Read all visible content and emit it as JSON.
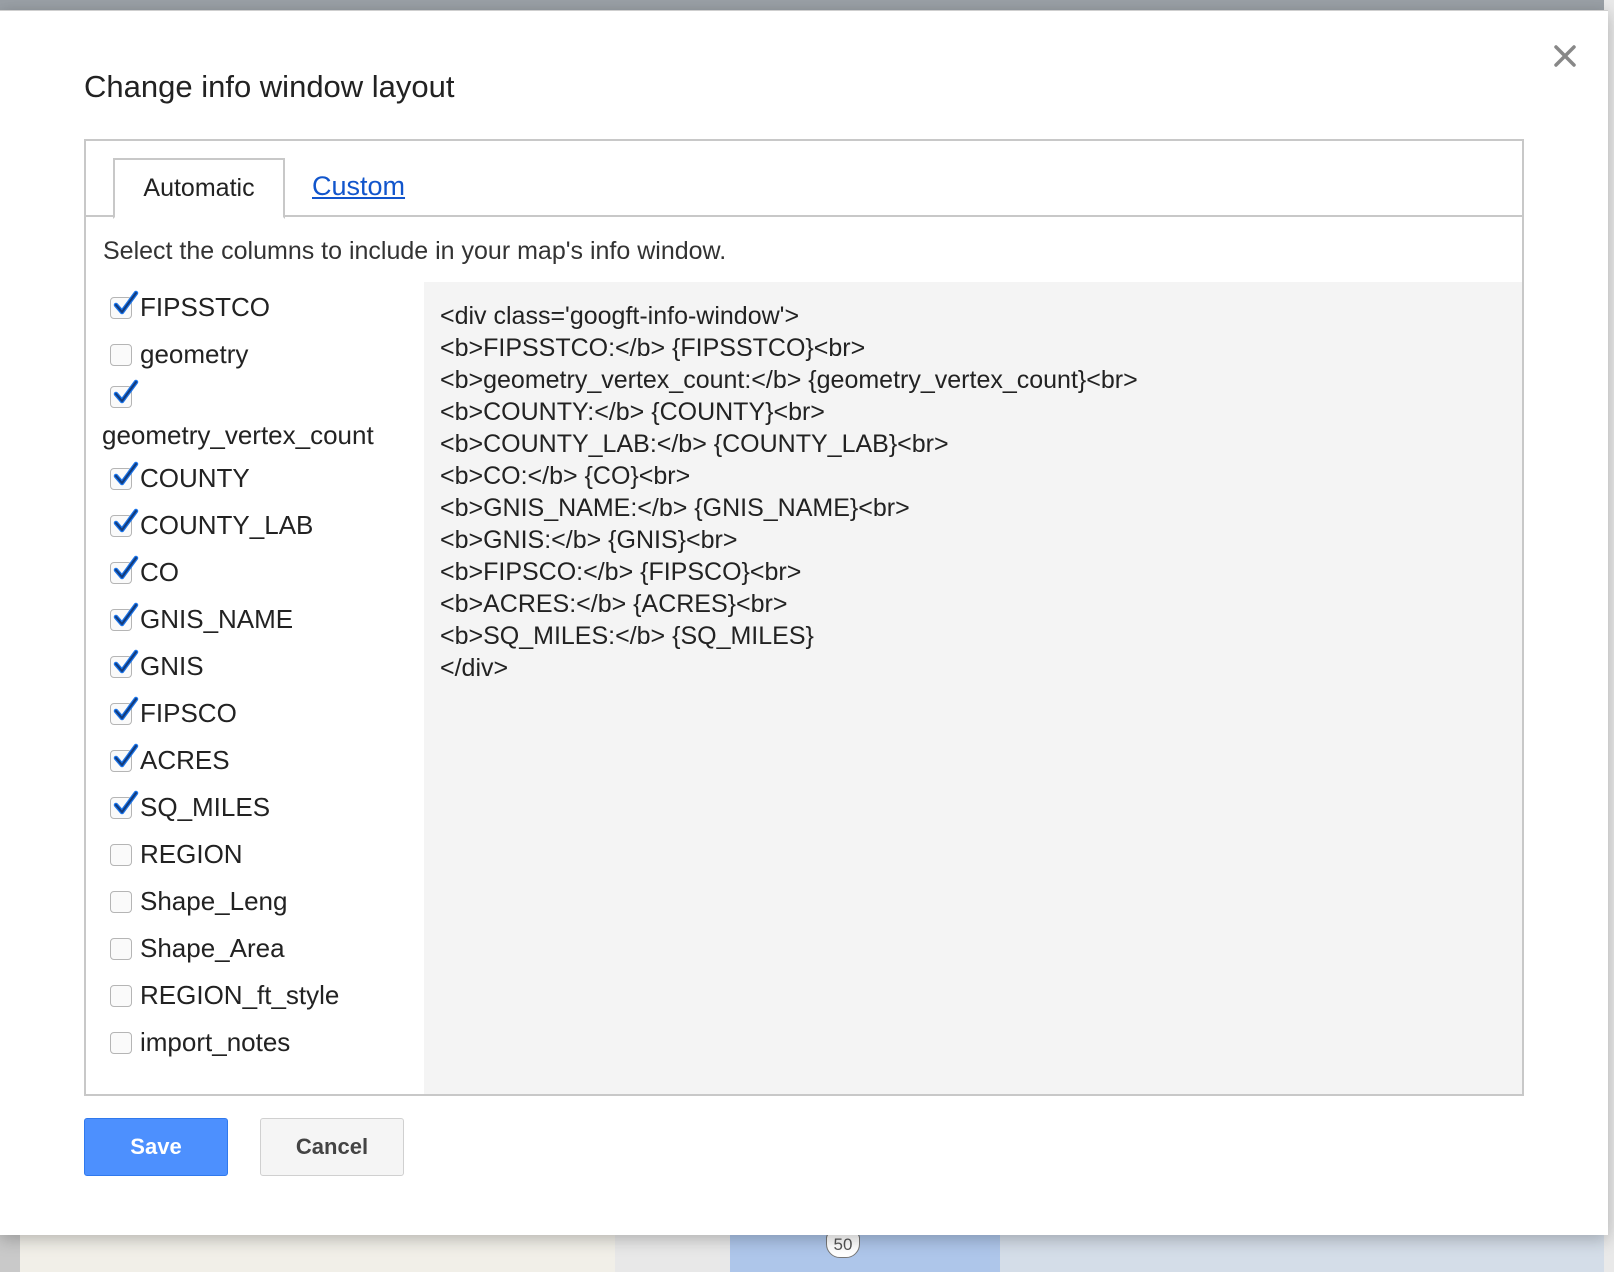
{
  "dialog": {
    "title": "Change info window layout",
    "close_icon": "close-icon"
  },
  "tabs": [
    {
      "label": "Automatic",
      "active": true
    },
    {
      "label": "Custom",
      "active": false
    }
  ],
  "instruction": "Select the columns to include in your map's info window.",
  "columns": [
    {
      "label": "FIPSSTCO",
      "checked": true
    },
    {
      "label": "geometry",
      "checked": false
    },
    {
      "label": "geometry_vertex_count",
      "checked": true
    },
    {
      "label": "COUNTY",
      "checked": true
    },
    {
      "label": "COUNTY_LAB",
      "checked": true
    },
    {
      "label": "CO",
      "checked": true
    },
    {
      "label": "GNIS_NAME",
      "checked": true
    },
    {
      "label": "GNIS",
      "checked": true
    },
    {
      "label": "FIPSCO",
      "checked": true
    },
    {
      "label": "ACRES",
      "checked": true
    },
    {
      "label": "SQ_MILES",
      "checked": true
    },
    {
      "label": "REGION",
      "checked": false
    },
    {
      "label": "Shape_Leng",
      "checked": false
    },
    {
      "label": "Shape_Area",
      "checked": false
    },
    {
      "label": "REGION_ft_style",
      "checked": false
    },
    {
      "label": "import_notes",
      "checked": false
    }
  ],
  "template": "<div class='googft-info-window'>\n<b>FIPSSTCO:</b> {FIPSSTCO}<br>\n<b>geometry_vertex_count:</b> {geometry_vertex_count}<br>\n<b>COUNTY:</b> {COUNTY}<br>\n<b>COUNTY_LAB:</b> {COUNTY_LAB}<br>\n<b>CO:</b> {CO}<br>\n<b>GNIS_NAME:</b> {GNIS_NAME}<br>\n<b>GNIS:</b> {GNIS}<br>\n<b>FIPSCO:</b> {FIPSCO}<br>\n<b>ACRES:</b> {ACRES}<br>\n<b>SQ_MILES:</b> {SQ_MILES}\n</div>",
  "buttons": {
    "save": "Save",
    "cancel": "Cancel"
  },
  "background": {
    "route_shield": "50"
  },
  "colors": {
    "save_blue": "#4d90fe",
    "link_blue": "#1155cc",
    "check_blue": "#1a73e8"
  }
}
